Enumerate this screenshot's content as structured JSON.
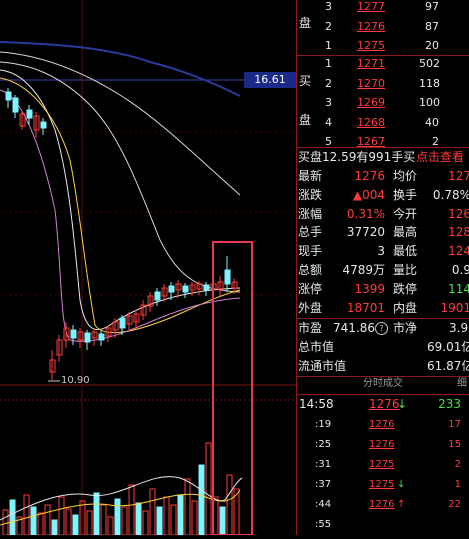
{
  "chart": {
    "price_tag": "16.61",
    "low_label": "10.90"
  },
  "orderbook": {
    "sell_side": "盘",
    "buy_side_1": "买",
    "buy_side_2": "盘",
    "sell_rows": [
      {
        "level": "3",
        "price": "1277",
        "vol": "97"
      },
      {
        "level": "2",
        "price": "1276",
        "vol": "87"
      },
      {
        "level": "1",
        "price": "1275",
        "vol": "20"
      }
    ],
    "buy_rows": [
      {
        "level": "1",
        "price": "1271",
        "vol": "502"
      },
      {
        "level": "2",
        "price": "1270",
        "vol": "118"
      },
      {
        "level": "3",
        "price": "1269",
        "vol": "100"
      },
      {
        "level": "4",
        "price": "1268",
        "vol": "40"
      },
      {
        "level": "5",
        "price": "1267",
        "vol": "2"
      }
    ]
  },
  "banner": {
    "text": "买盘12.59有991手买",
    "link": "点击查看"
  },
  "stats": [
    {
      "l1": "最新",
      "v1": "1276",
      "l2": "均价",
      "v2": "127"
    },
    {
      "l1": "涨跌",
      "v1": "▲004",
      "l2": "换手",
      "v2": "0.78%"
    },
    {
      "l1": "涨幅",
      "v1": "0.31%",
      "l2": "今开",
      "v2": "126"
    },
    {
      "l1": "总手",
      "v1": "37720",
      "l2": "最高",
      "v2": "128"
    },
    {
      "l1": "现手",
      "v1": "3",
      "l2": "最低",
      "v2": "124"
    },
    {
      "l1": "总额",
      "v1": "4789",
      "v1u": "万",
      "l2": "量比",
      "v2": "0.9"
    },
    {
      "l1": "涨停",
      "v1": "1399",
      "l2": "跌停",
      "v2": "114"
    },
    {
      "l1": "外盘",
      "v1": "18701",
      "l2": "内盘",
      "v2": "1901"
    }
  ],
  "valuation": {
    "pe_label": "市盈",
    "pe_value": "741.86",
    "pe_icon": "circle-info-icon",
    "pb_label": "市净",
    "pb_value": "3.9",
    "mcap_label": "总市值",
    "mcap_value": "69.01亿",
    "float_label": "流通市值",
    "float_value": "61.87亿"
  },
  "ticks": {
    "header": "分时成交",
    "header2": "细",
    "rows": [
      {
        "time": "14:58",
        "price": "1276",
        "dir": "↓",
        "vol": "233"
      },
      {
        "time": ":19",
        "price": "1276",
        "dir": "",
        "vol": "17"
      },
      {
        "time": ":25",
        "price": "1276",
        "dir": "",
        "vol": "15"
      },
      {
        "time": ":31",
        "price": "1275",
        "dir": "",
        "vol": "2"
      },
      {
        "time": ":37",
        "price": "1275",
        "dir": "↓",
        "vol": "1"
      },
      {
        "time": ":44",
        "price": "1276",
        "dir": "↑",
        "vol": "22"
      },
      {
        "time": ":55",
        "price": "",
        "dir": "",
        "vol": ""
      }
    ]
  },
  "colors": {
    "up": "#ff3b3b",
    "down": "#3fe04a",
    "border": "#8b1a1a",
    "highlight": "#e23a4a"
  }
}
